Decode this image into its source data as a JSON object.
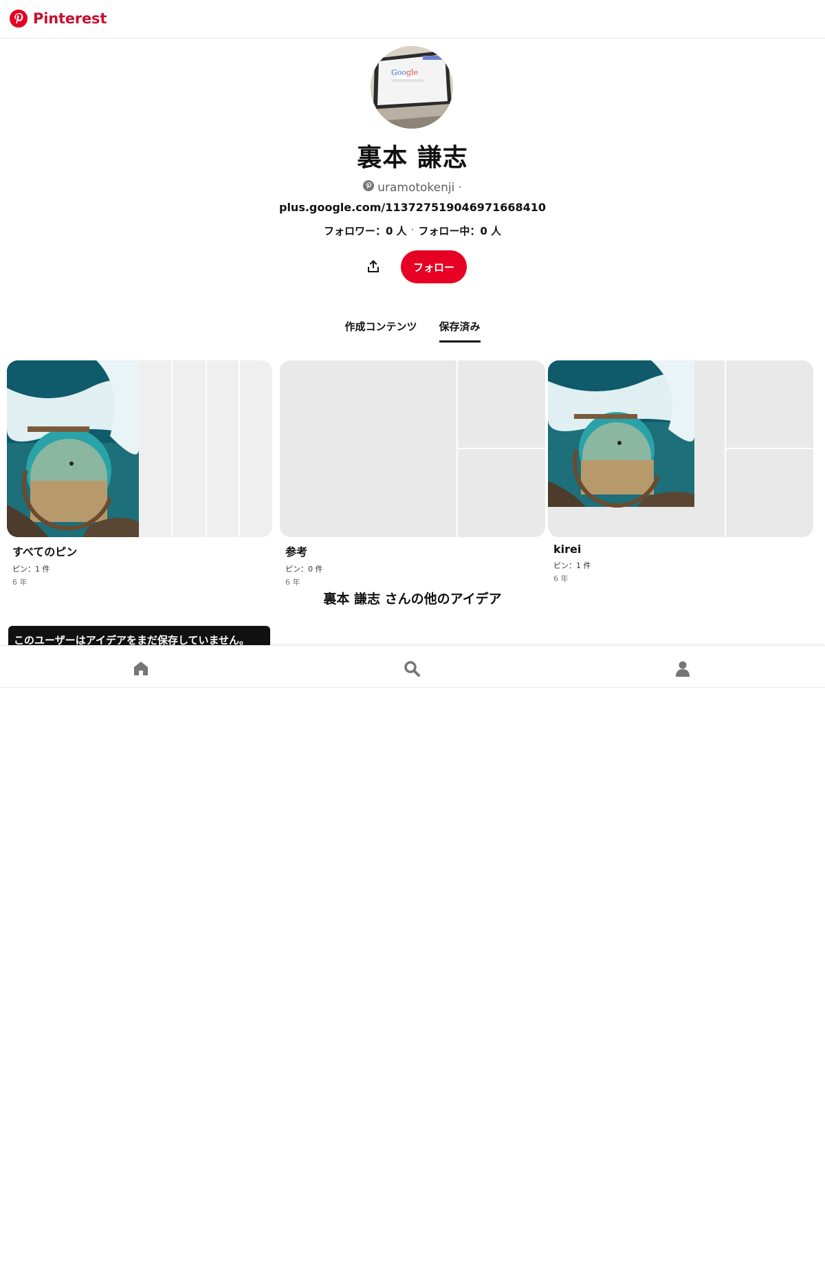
{
  "header": {
    "brand": "Pinterest",
    "brand_color": "#c8102e",
    "icon": "pinterest-logo-icon"
  },
  "profile": {
    "name": "裏本 謙志",
    "handle": "uramotokenji",
    "handle_separator": "·",
    "website": "plus.google.com/113727519046971668410",
    "followers": "フォロワー：0 人",
    "stat_separator": "·",
    "following": "フォロー中：0 人",
    "share_icon": "share-icon",
    "follow_label": "フォロー",
    "follow_color": "#e60023"
  },
  "tabs": [
    {
      "label": "作成コンテンツ",
      "active": false
    },
    {
      "label": "保存済み",
      "active": true
    }
  ],
  "boards": [
    {
      "title": "すべてのピン",
      "pins": "ピン：1 件",
      "age": "6 年"
    },
    {
      "title": "参考",
      "pins": "ピン：0 件",
      "age": "6 年"
    },
    {
      "title": "kirei",
      "pins": "ピン：1 件",
      "age": "6 年"
    }
  ],
  "more_ideas": "裏本 謙志 さんの他のアイデア",
  "toast": "このユーザーはアイデアをまだ保存していません。",
  "bottom_nav": [
    {
      "icon": "home-icon"
    },
    {
      "icon": "search-icon"
    },
    {
      "icon": "profile-icon"
    }
  ]
}
